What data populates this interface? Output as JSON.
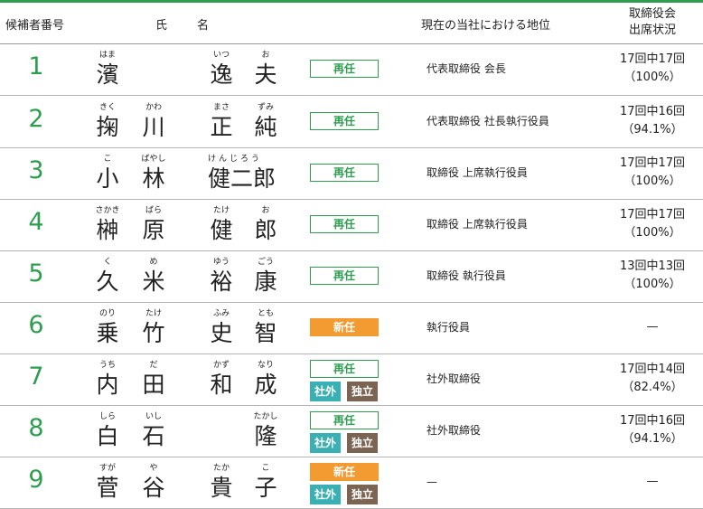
{
  "header": {
    "candidate_no": "候補者番号",
    "name_1": "氏",
    "name_2": "名",
    "position": "現在の当社における地位",
    "attendance_line1": "取締役会",
    "attendance_line2": "出席状況"
  },
  "colors": {
    "accent_green": "#2e9d4f",
    "new_orange": "#f39a31",
    "outside_teal": "#3bb0b4",
    "independent_brown": "#7b6452"
  },
  "rows": [
    {
      "num": "1",
      "chars": [
        {
          "k": "濱",
          "r": "はま"
        },
        {
          "k": "",
          "r": ""
        },
        {
          "k": "逸",
          "r": "いつ"
        },
        {
          "k": "夫",
          "r": "お"
        }
      ],
      "status": "再任",
      "outside": "",
      "independent": "",
      "position": "代表取締役 会長",
      "attendance_1": "17回中17回",
      "attendance_2": "（100%）"
    },
    {
      "num": "2",
      "chars": [
        {
          "k": "掬",
          "r": "きく"
        },
        {
          "k": "川",
          "r": "かわ"
        },
        {
          "k": "正",
          "r": "まさ"
        },
        {
          "k": "純",
          "r": "ずみ"
        }
      ],
      "status": "再任",
      "outside": "",
      "independent": "",
      "position": "代表取締役 社長執行役員",
      "attendance_1": "17回中16回",
      "attendance_2": "（94.1%）"
    },
    {
      "num": "3",
      "chars": [
        {
          "k": "小",
          "r": "こ"
        },
        {
          "k": "林",
          "r": "ばやし"
        },
        {
          "k": "健二郎",
          "r": "けんじろう"
        },
        {
          "k": "",
          "r": ""
        }
      ],
      "status": "再任",
      "outside": "",
      "independent": "",
      "position": "取締役 上席執行役員",
      "attendance_1": "17回中17回",
      "attendance_2": "（100%）"
    },
    {
      "num": "4",
      "chars": [
        {
          "k": "榊",
          "r": "さかき"
        },
        {
          "k": "原",
          "r": "ばら"
        },
        {
          "k": "健",
          "r": "たけ"
        },
        {
          "k": "郎",
          "r": "お"
        }
      ],
      "status": "再任",
      "outside": "",
      "independent": "",
      "position": "取締役 上席執行役員",
      "attendance_1": "17回中17回",
      "attendance_2": "（100%）"
    },
    {
      "num": "5",
      "chars": [
        {
          "k": "久",
          "r": "く"
        },
        {
          "k": "米",
          "r": "め"
        },
        {
          "k": "裕",
          "r": "ゆう"
        },
        {
          "k": "康",
          "r": "ごう"
        }
      ],
      "status": "再任",
      "outside": "",
      "independent": "",
      "position": "取締役 執行役員",
      "attendance_1": "13回中13回",
      "attendance_2": "（100%）"
    },
    {
      "num": "6",
      "chars": [
        {
          "k": "乗",
          "r": "のり"
        },
        {
          "k": "竹",
          "r": "たけ"
        },
        {
          "k": "史",
          "r": "ふみ"
        },
        {
          "k": "智",
          "r": "とも"
        }
      ],
      "status": "新任",
      "outside": "",
      "independent": "",
      "position": "執行役員",
      "attendance_1": "—",
      "attendance_2": ""
    },
    {
      "num": "7",
      "chars": [
        {
          "k": "内",
          "r": "うち"
        },
        {
          "k": "田",
          "r": "だ"
        },
        {
          "k": "和",
          "r": "かず"
        },
        {
          "k": "成",
          "r": "なり"
        }
      ],
      "status": "再任",
      "outside": "社外",
      "independent": "独立",
      "position": "社外取締役",
      "attendance_1": "17回中14回",
      "attendance_2": "（82.4%）"
    },
    {
      "num": "8",
      "chars": [
        {
          "k": "白",
          "r": "しら"
        },
        {
          "k": "石",
          "r": "いし"
        },
        {
          "k": "",
          "r": ""
        },
        {
          "k": "隆",
          "r": "たかし"
        }
      ],
      "status": "再任",
      "outside": "社外",
      "independent": "独立",
      "position": "社外取締役",
      "attendance_1": "17回中16回",
      "attendance_2": "（94.1%）"
    },
    {
      "num": "9",
      "chars": [
        {
          "k": "菅",
          "r": "すが"
        },
        {
          "k": "谷",
          "r": "や"
        },
        {
          "k": "貴",
          "r": "たか"
        },
        {
          "k": "子",
          "r": "こ"
        }
      ],
      "status": "新任",
      "outside": "社外",
      "independent": "独立",
      "position": "—",
      "attendance_1": "—",
      "attendance_2": ""
    }
  ]
}
